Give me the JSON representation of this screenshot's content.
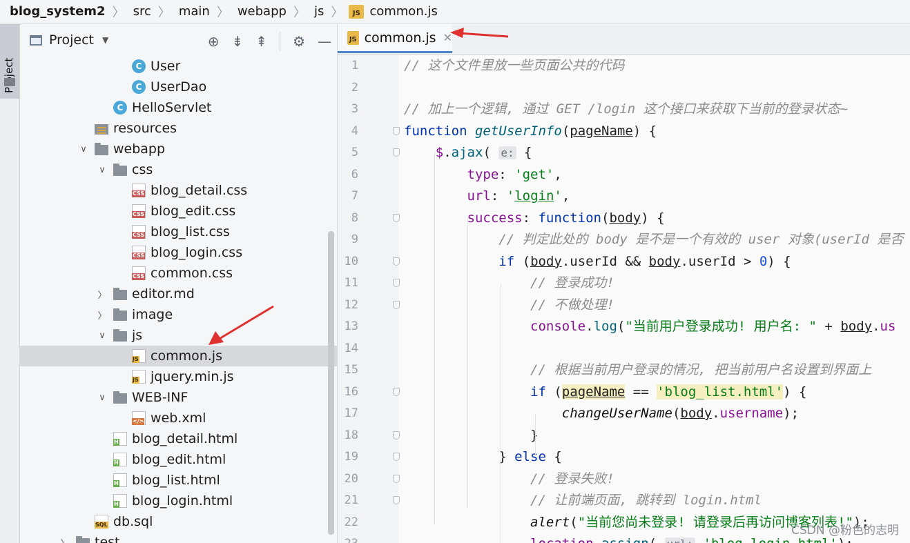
{
  "breadcrumb": [
    "blog_system2",
    "src",
    "main",
    "webapp",
    "js",
    "common.js"
  ],
  "toolstrip": {
    "project_tab": "Project"
  },
  "project_panel": {
    "title": "Project",
    "items": [
      {
        "label": "User",
        "icon": "class-icon",
        "depth": 6,
        "arrow": ""
      },
      {
        "label": "UserDao",
        "icon": "class-icon",
        "depth": 6,
        "arrow": ""
      },
      {
        "label": "HelloServlet",
        "icon": "class-icon",
        "depth": 5,
        "arrow": ""
      },
      {
        "label": "resources",
        "icon": "resources-folder-icon",
        "depth": 4,
        "arrow": ""
      },
      {
        "label": "webapp",
        "icon": "folder-icon",
        "depth": 4,
        "arrow": "down"
      },
      {
        "label": "css",
        "icon": "folder-icon",
        "depth": 5,
        "arrow": "down"
      },
      {
        "label": "blog_detail.css",
        "icon": "css-file-icon",
        "depth": 6,
        "arrow": ""
      },
      {
        "label": "blog_edit.css",
        "icon": "css-file-icon",
        "depth": 6,
        "arrow": ""
      },
      {
        "label": "blog_list.css",
        "icon": "css-file-icon",
        "depth": 6,
        "arrow": ""
      },
      {
        "label": "blog_login.css",
        "icon": "css-file-icon",
        "depth": 6,
        "arrow": ""
      },
      {
        "label": "common.css",
        "icon": "css-file-icon",
        "depth": 6,
        "arrow": ""
      },
      {
        "label": "editor.md",
        "icon": "folder-icon",
        "depth": 5,
        "arrow": "right"
      },
      {
        "label": "image",
        "icon": "folder-icon",
        "depth": 5,
        "arrow": "right"
      },
      {
        "label": "js",
        "icon": "folder-icon",
        "depth": 5,
        "arrow": "down"
      },
      {
        "label": "common.js",
        "icon": "js-file-icon",
        "depth": 6,
        "arrow": "",
        "selected": true
      },
      {
        "label": "jquery.min.js",
        "icon": "js-file-icon",
        "depth": 6,
        "arrow": ""
      },
      {
        "label": "WEB-INF",
        "icon": "folder-icon",
        "depth": 5,
        "arrow": "down"
      },
      {
        "label": "web.xml",
        "icon": "xml-file-icon",
        "depth": 6,
        "arrow": ""
      },
      {
        "label": "blog_detail.html",
        "icon": "html-file-icon",
        "depth": 5,
        "arrow": ""
      },
      {
        "label": "blog_edit.html",
        "icon": "html-file-icon",
        "depth": 5,
        "arrow": ""
      },
      {
        "label": "blog_list.html",
        "icon": "html-file-icon",
        "depth": 5,
        "arrow": ""
      },
      {
        "label": "blog_login.html",
        "icon": "html-file-icon",
        "depth": 5,
        "arrow": ""
      },
      {
        "label": "db.sql",
        "icon": "sql-file-icon",
        "depth": 4,
        "arrow": ""
      },
      {
        "label": "test",
        "icon": "folder-icon",
        "depth": 3,
        "arrow": "right"
      }
    ]
  },
  "editor": {
    "tab_label": "common.js",
    "lines": [
      {
        "n": "1",
        "html": "<span class='cmt'>// 这个文件里放一些页面公共的代码</span>"
      },
      {
        "n": "2",
        "html": ""
      },
      {
        "n": "3",
        "html": "<span class='cmt'>// 加上一个逻辑, 通过 GET /login 这个接口来获取下当前的登录状态~</span>"
      },
      {
        "n": "4",
        "html": "<span class='kw'>function</span> <span class='fn'>getUserInfo</span>(<span class='ul'>pageName</span>) {"
      },
      {
        "n": "5",
        "html": "    <span class='prop'>$</span>.<span class='fn' style='font-style:normal;color:#00627a'>ajax</span>( <span class='hint'>e:</span> {"
      },
      {
        "n": "6",
        "html": "        <span class='prop'>type</span>: <span class='str'>'get'</span>,"
      },
      {
        "n": "7",
        "html": "        <span class='prop'>url</span>: <span class='str'>'<span class=\"ul\">login</span>'</span>,"
      },
      {
        "n": "8",
        "html": "        <span class='prop'>success</span>: <span class='kw'>function</span>(<span class='ul'>body</span>) {"
      },
      {
        "n": "9",
        "html": "            <span class='cmt'>// 判定此处的 body 是不是一个有效的 user 对象(userId 是否</span>"
      },
      {
        "n": "10",
        "html": "            <span class='kw'>if</span> (<span class='ul'>body</span>.userId &amp;&amp; <span class='ul'>body</span>.userId &gt; <span class='num'>0</span>) {"
      },
      {
        "n": "11",
        "html": "                <span class='cmt'>// 登录成功!</span>"
      },
      {
        "n": "12",
        "html": "                <span class='cmt'>// 不做处理!</span>"
      },
      {
        "n": "13",
        "html": "                <span class='prop'>console</span>.<span style='color:#00627a'>log</span>(<span class='str'>\"当前用户登录成功! 用户名: \"</span> + <span class='ul'>body</span>.<span class='prop'>us</span>"
      },
      {
        "n": "14",
        "html": ""
      },
      {
        "n": "15",
        "html": "                <span class='cmt'>// 根据当前用户登录的情况, 把当前用户名设置到界面上</span>"
      },
      {
        "n": "16",
        "html": "                <span class='kw'>if</span> (<span class='ul hl'>pageName</span> == <span class='str hl'>'blog_list.html'</span>) {"
      },
      {
        "n": "17",
        "html": "                    <span class='fn' style='color:#111'>changeUserName</span>(<span class='ul'>body</span>.<span class='prop'>username</span>);"
      },
      {
        "n": "18",
        "html": "                }"
      },
      {
        "n": "19",
        "html": "            } <span class='kw'>else</span> {"
      },
      {
        "n": "20",
        "html": "                <span class='cmt'>// 登录失败!</span>"
      },
      {
        "n": "21",
        "html": "                <span class='cmt'>// 让前端页面, 跳转到 login.html</span>"
      },
      {
        "n": "22",
        "html": "                <span class='fn' style='color:#111'>alert</span>(<span class='str'>\"当前您尚未登录! 请登录后再访问博客列表!\"</span>);"
      },
      {
        "n": "23",
        "html": "                <span class='prop'>location</span>.<span style='color:#00627a'>assign</span>( <span class='hint'>url:</span> <span class='str'>'blog_login.html'</span>);"
      }
    ]
  },
  "watermark": "CSDN @粉色的志明",
  "colors": {
    "accent": "#4a86c7",
    "annotation_arrow": "#e03030"
  }
}
